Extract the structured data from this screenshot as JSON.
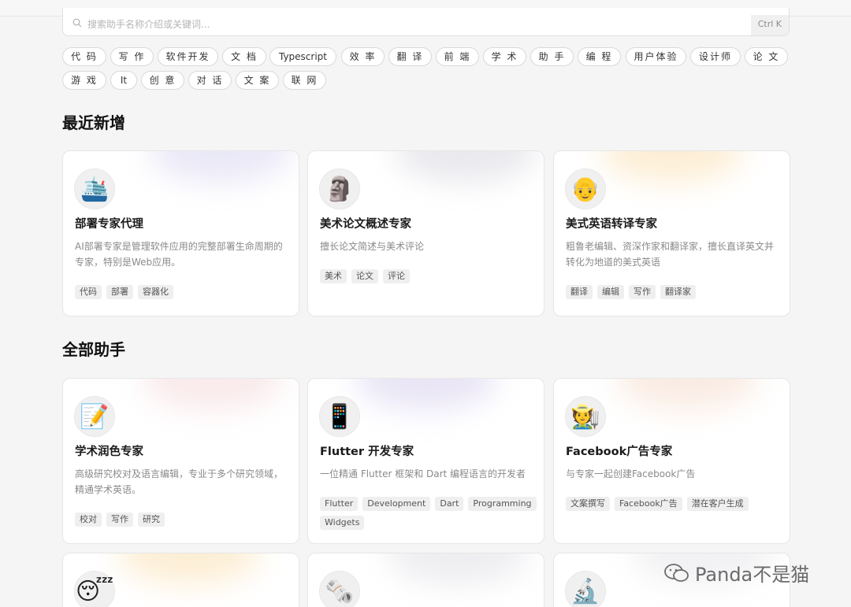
{
  "search": {
    "placeholder": "搜索助手名称介绍或关键词...",
    "shortcut": "Ctrl K"
  },
  "tags": [
    "代 码",
    "写 作",
    "软件开发",
    "文 档",
    "Typescript",
    "效 率",
    "翻 译",
    "前 端",
    "学 术",
    "助 手",
    "编 程",
    "用户体验",
    "设计师",
    "论 文",
    "游 戏",
    "It",
    "创 意",
    "对 话",
    "文 案",
    "联 网"
  ],
  "sections": {
    "recent": "最近新增",
    "all": "全部助手"
  },
  "recent_cards": [
    {
      "emoji": "🛳️",
      "icon": "ship-icon",
      "title": "部署专家代理",
      "desc": "AI部署专家是管理软件应用的完整部署生命周期的专家，特别是Web应用。",
      "tags": [
        "代码",
        "部署",
        "容器化"
      ],
      "accent": "#d9d6f0"
    },
    {
      "emoji": "🗿",
      "icon": "moai-icon",
      "title": "美术论文概述专家",
      "desc": "擅长论文简述与美术评论",
      "tags": [
        "美术",
        "论文",
        "评论"
      ],
      "accent": "#d8d8e0"
    },
    {
      "emoji": "👴",
      "icon": "old-man-icon",
      "title": "美式英语转译专家",
      "desc": "粗鲁老编辑、资深作家和翻译家，擅长直译英文并转化为地道的美式英语",
      "tags": [
        "翻译",
        "编辑",
        "写作",
        "翻译家"
      ],
      "accent": "#fbe1b4"
    }
  ],
  "all_cards": [
    {
      "emoji": "📝",
      "icon": "memo-icon",
      "title": "学术润色专家",
      "desc": "高级研究校对及语言编辑，专业于多个研究领域，精通学术英语。",
      "tags": [
        "校对",
        "写作",
        "研究"
      ],
      "accent": "#f5d9dc"
    },
    {
      "emoji": "📱",
      "icon": "phone-icon",
      "title": "Flutter 开发专家",
      "desc": "一位精通 Flutter 框架和 Dart 编程语言的开发者",
      "tags": [
        "Flutter",
        "Development",
        "Dart",
        "Programming",
        "Widgets"
      ],
      "accent": "#d7d0ee"
    },
    {
      "emoji": "🧑‍🌾",
      "icon": "farmer-icon",
      "title": "Facebook广告专家",
      "desc": "与专家一起创建Facebook广告",
      "tags": [
        "文案撰写",
        "Facebook广告",
        "潜在客户生成"
      ],
      "accent": "#f6dccd"
    }
  ],
  "bottom_cards": [
    {
      "emoji": "😴",
      "icon": "sleeping-face-icon",
      "accent": "#fbe1b4"
    },
    {
      "emoji": "🗞️",
      "icon": "newspaper-icon",
      "accent": "#e0e0e6"
    },
    {
      "emoji": "🔬",
      "icon": "microscope-icon",
      "accent": "#e6e6ea"
    }
  ],
  "watermark": "Panda不是猫",
  "colors": {
    "background": "#f5f5f5",
    "card": "#ffffff",
    "chip": "#efefef"
  }
}
